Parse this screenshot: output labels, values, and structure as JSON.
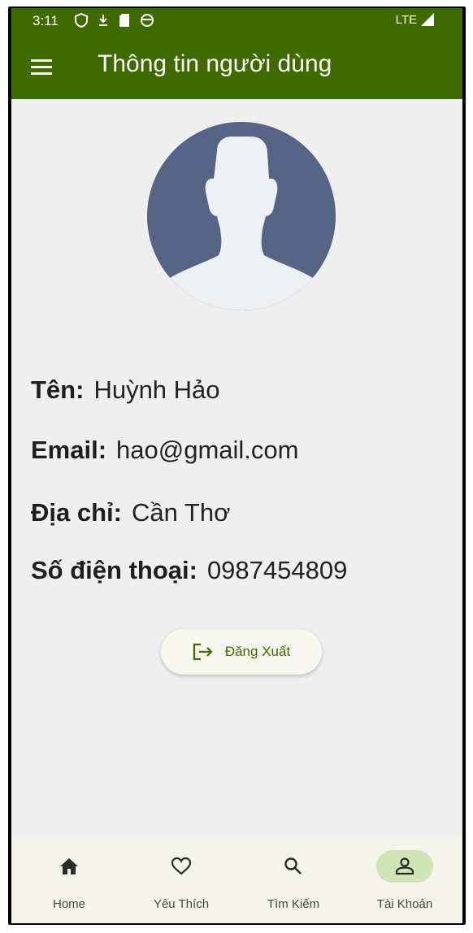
{
  "status_bar": {
    "time": "3:11",
    "network": "LTE"
  },
  "app_bar": {
    "title": "Thông tin người dùng"
  },
  "profile": {
    "fields": [
      {
        "label": "Tên:",
        "value": "Huỳnh Hảo"
      },
      {
        "label": "Email:",
        "value": "hao@gmail.com"
      },
      {
        "label": "Địa chỉ:",
        "value": "Cần Thơ"
      },
      {
        "label": "Số điện thoại:",
        "value": "0987454809"
      }
    ]
  },
  "logout_button": {
    "label": "Đăng Xuất"
  },
  "bottom_nav": {
    "items": [
      {
        "label": "Home",
        "icon": "home-icon"
      },
      {
        "label": "Yêu Thích",
        "icon": "heart-icon"
      },
      {
        "label": "Tìm Kiếm",
        "icon": "search-icon"
      },
      {
        "label": "Tài Khoản",
        "icon": "person-icon",
        "active": true
      }
    ]
  },
  "colors": {
    "primary": "#3f6a00",
    "background": "#efefef",
    "avatar": "#566485",
    "nav_active": "#cfe5b5"
  }
}
